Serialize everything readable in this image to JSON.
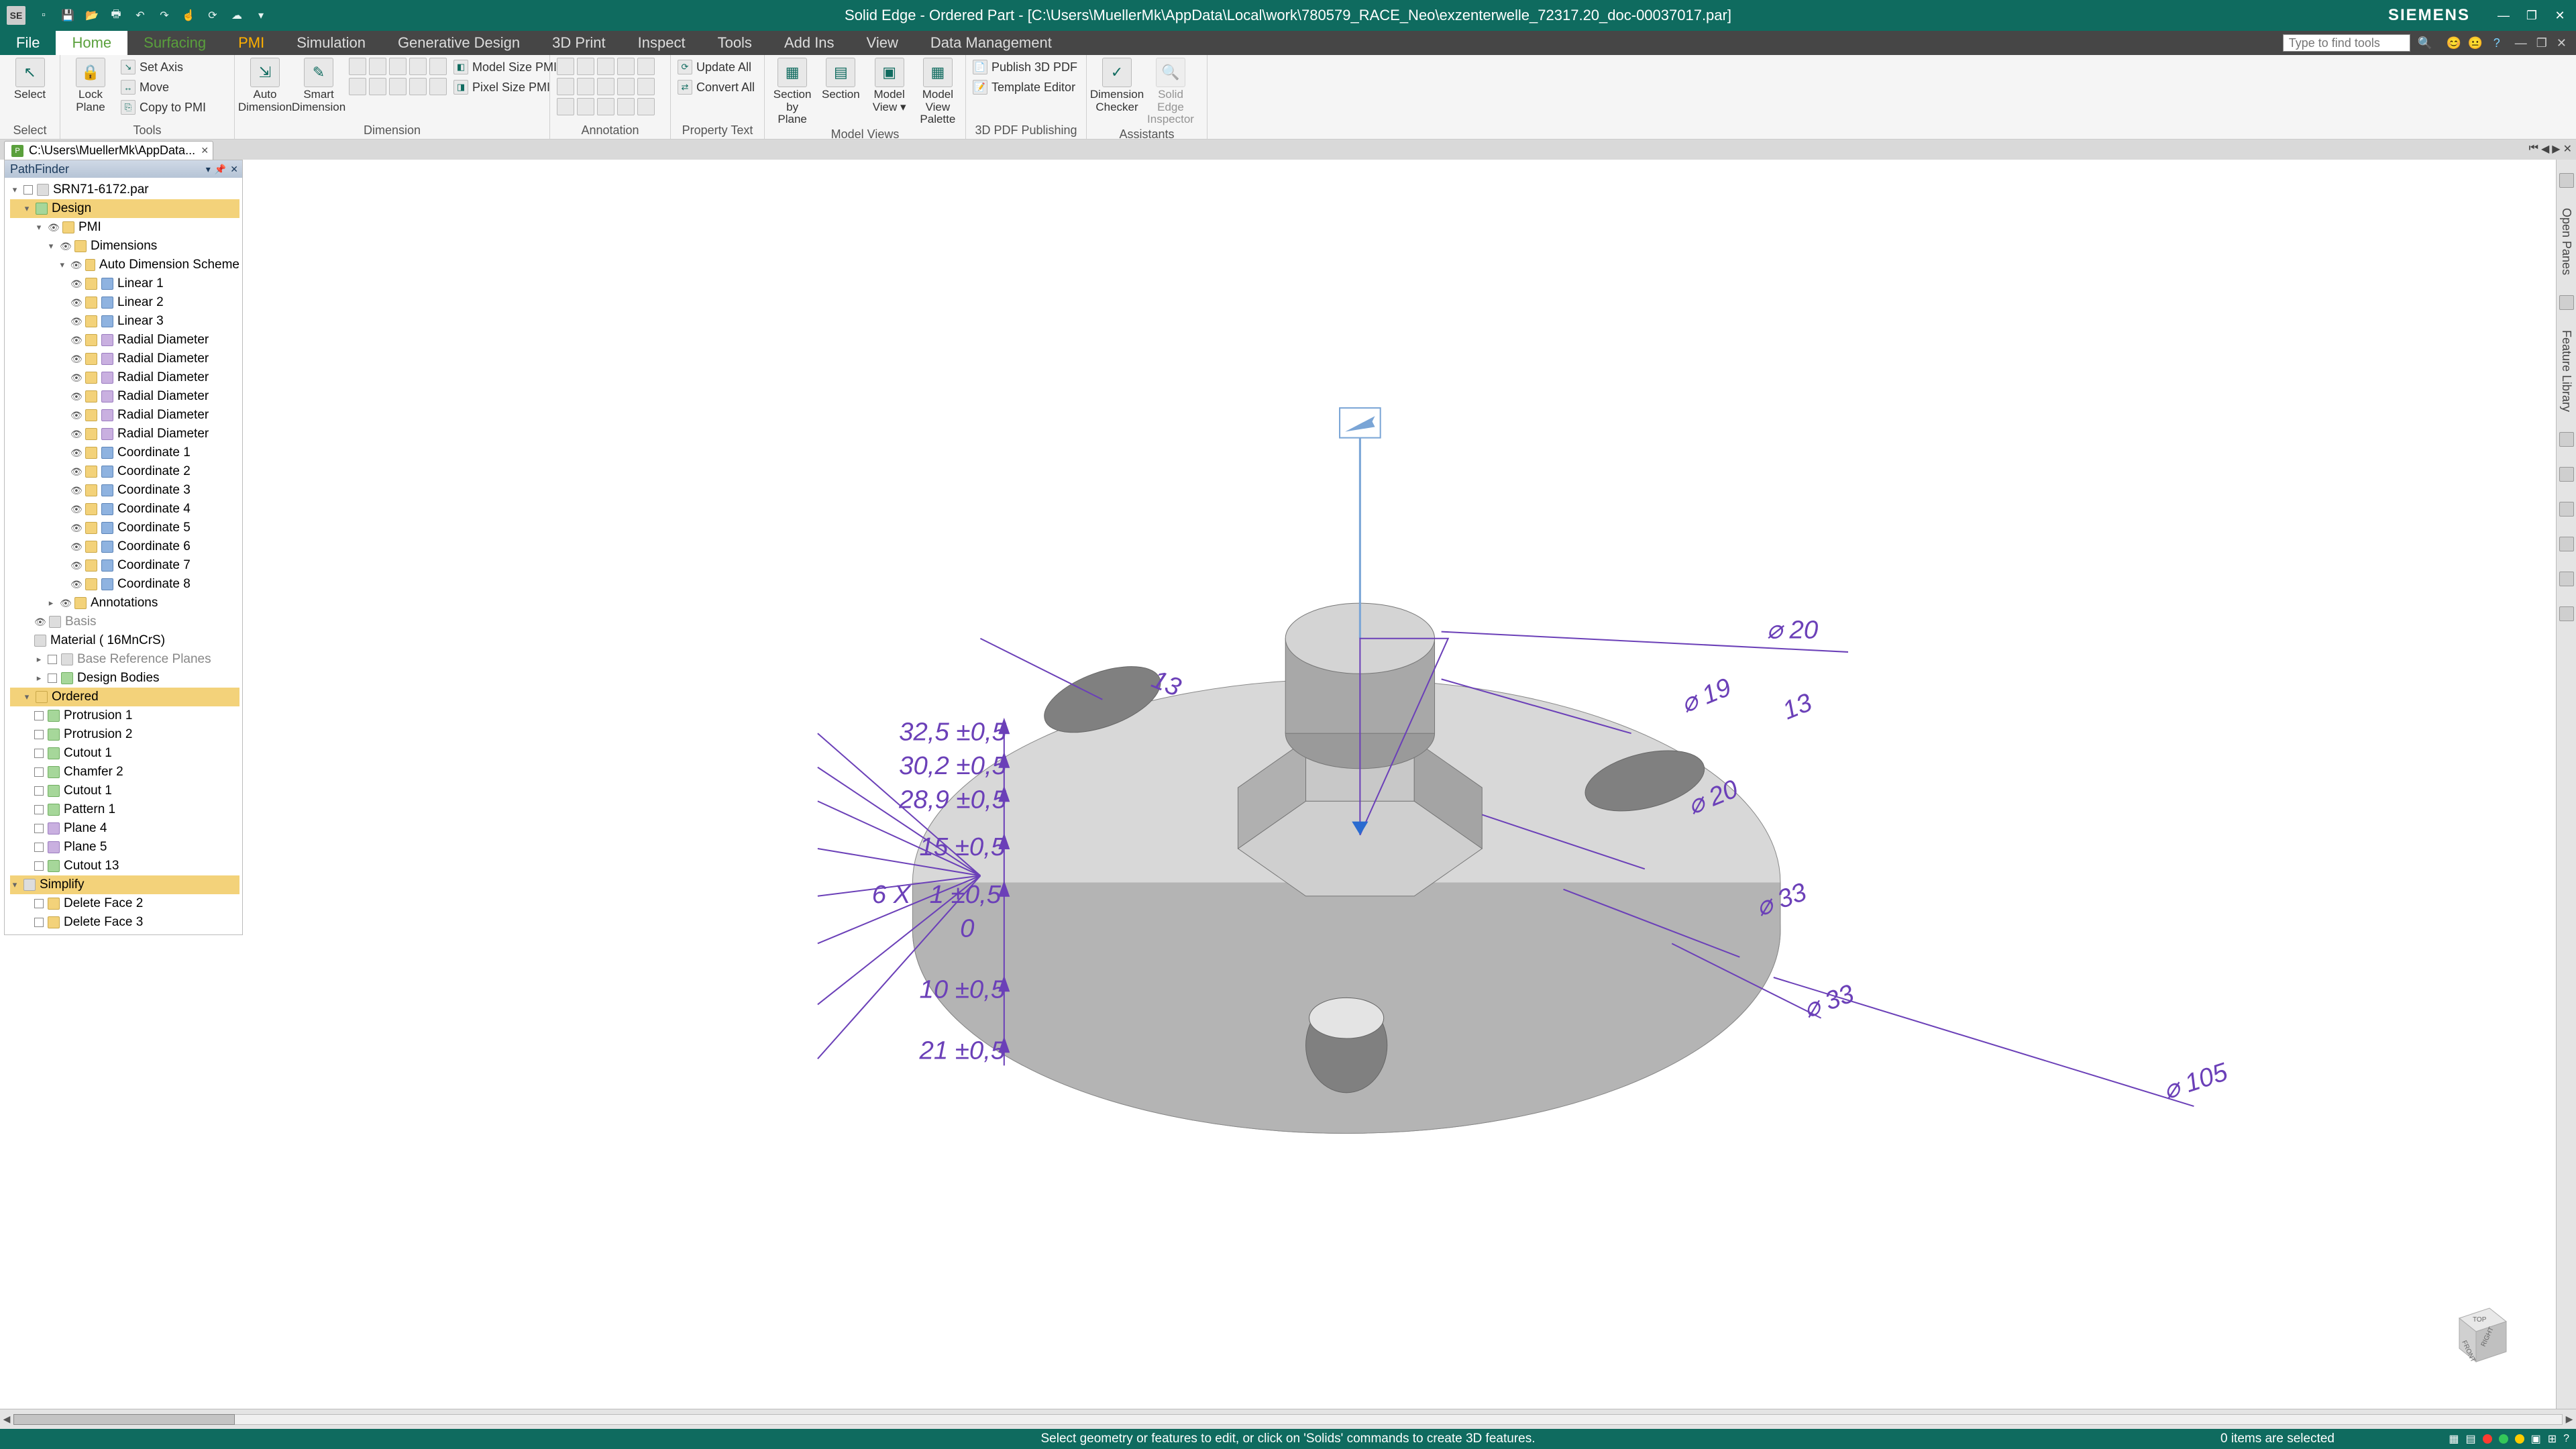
{
  "title": "Solid Edge - Ordered Part - [C:\\Users\\MuellerMk\\AppData\\Local\\work\\780579_RACE_Neo\\exzenterwelle_72317.20_doc-00037017.par]",
  "brand": "SIEMENS",
  "qat_icons": [
    "new-doc",
    "save",
    "open",
    "print",
    "undo",
    "redo",
    "touch",
    "sync",
    "view",
    "cloud"
  ],
  "win_controls": [
    "minimize",
    "restore",
    "close"
  ],
  "menu": {
    "file": "File",
    "tabs": [
      "Home",
      "Surfacing",
      "PMI",
      "Simulation",
      "Generative Design",
      "3D Print",
      "Inspect",
      "Tools",
      "Add Ins",
      "View",
      "Data Management"
    ],
    "active": "Home",
    "search_placeholder": "Type to find tools"
  },
  "smile_icons": [
    "😊",
    "😐",
    "?"
  ],
  "ribbon": {
    "select": {
      "big": "Select",
      "label": "Select"
    },
    "planes": {
      "big": "Lock\nPlane",
      "items": [
        "Set Axis",
        "Move",
        "Copy to PMI"
      ],
      "label": "Tools"
    },
    "dim": {
      "big1": "Auto\nDimension",
      "big2": "Smart\nDimension",
      "items": [
        "Model Size PMI",
        "Pixel Size PMI"
      ],
      "label": "Dimension"
    },
    "annot": {
      "label": "Annotation"
    },
    "update": {
      "items": [
        "Update All",
        "Convert All"
      ],
      "label": "Property Text"
    },
    "views": {
      "big1": "Section\nby Plane",
      "big2": "Section",
      "big3": "Model\nView ▾",
      "big4": "Model View\nPalette",
      "label": "Model Views"
    },
    "pdf": {
      "items": [
        "Publish 3D PDF",
        "Template Editor"
      ],
      "label": "3D PDF Publishing"
    },
    "assist": {
      "big1": "Dimension\nChecker",
      "big2": "Solid Edge\nInspector",
      "label": "Assistants"
    }
  },
  "doctab": {
    "text": "C:\\Users\\MuellerMk\\AppData..."
  },
  "pathfinder": {
    "title": "PathFinder",
    "root": "SRN71-6172.par",
    "design": "Design",
    "pmi": "PMI",
    "dimensions": "Dimensions",
    "auto_scheme": "Auto Dimension Scheme",
    "linear": [
      "Linear 1",
      "Linear 2",
      "Linear 3"
    ],
    "radial": [
      "Radial Diameter",
      "Radial Diameter",
      "Radial Diameter",
      "Radial Diameter",
      "Radial Diameter",
      "Radial Diameter"
    ],
    "coord": [
      "Coordinate 1",
      "Coordinate 2",
      "Coordinate 3",
      "Coordinate 4",
      "Coordinate 5",
      "Coordinate 6",
      "Coordinate 7",
      "Coordinate 8"
    ],
    "annotations": "Annotations",
    "basis": "Basis",
    "material": "Material ( 16MnCrS)",
    "base_ref": "Base Reference Planes",
    "design_bodies": "Design Bodies",
    "ordered": "Ordered",
    "ord_items": [
      "Protrusion 1",
      "Protrusion 2",
      "Cutout 1",
      "Chamfer 2",
      "Cutout 1",
      "Pattern 1",
      "Plane 4",
      "Plane 5",
      "Cutout 13"
    ],
    "simplify": "Simplify",
    "simp_items": [
      "Delete Face 2",
      "Delete Face 3"
    ]
  },
  "rightdock_tabs": [
    "Open Panes",
    "Feature Library",
    "",
    "",
    "",
    "",
    ""
  ],
  "dims": {
    "d20a": "⌀ 20",
    "d19": "⌀ 19",
    "d20b": "⌀ 20",
    "d33a": "⌀ 33",
    "d33b": "⌀ 33",
    "d105": "⌀ 105",
    "l13a": "13",
    "l13b": "13",
    "s325": "32,5 ±0,5",
    "s302": "30,2 ±0,5",
    "s289": "28,9 ±0,5",
    "s15": "15 ±0,5",
    "s6x": "6 X",
    "s1": "1 ±0,5",
    "s0": "0",
    "s10": "10 ±0,5",
    "s21": "21 ±0,5"
  },
  "viewcube": {
    "front": "FRONT",
    "right": "RIGHT",
    "top": "TOP"
  },
  "status": {
    "hint": "Select geometry or features to edit, or click on 'Solids' commands to create 3D features.",
    "selection": "0 items are selected"
  }
}
